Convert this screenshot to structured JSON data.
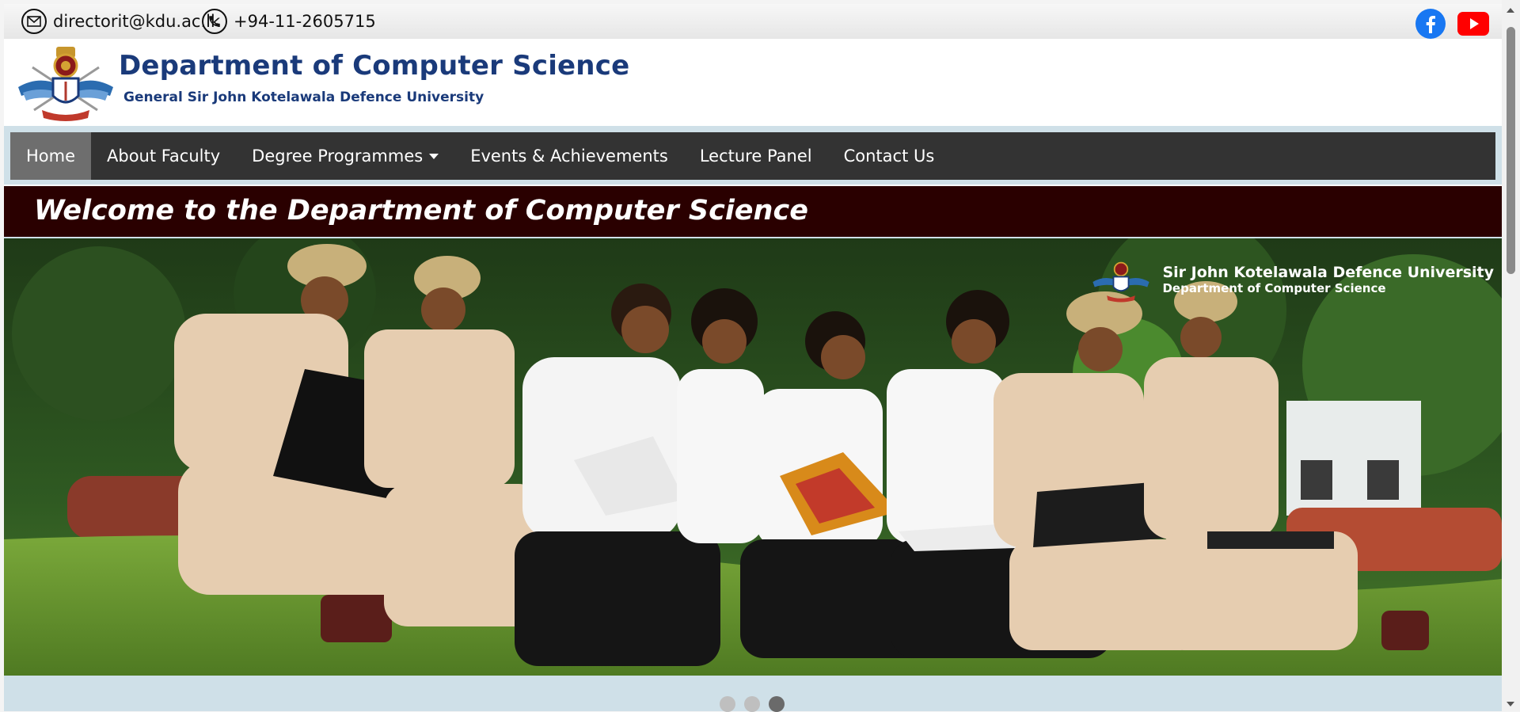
{
  "topbar": {
    "email": "directorit@kdu.ac.lk",
    "phone": "+94-11-2605715",
    "email_icon": "envelope-icon",
    "phone_icon": "phone-icon",
    "social": [
      {
        "name": "facebook-icon",
        "color": "#1877F2"
      },
      {
        "name": "youtube-icon",
        "color": "#FF0000"
      }
    ]
  },
  "header": {
    "title": "Department of Computer Science",
    "subtitle": "General Sir John Kotelawala Defence University",
    "logo": "kdu-crest-logo"
  },
  "nav": {
    "items": [
      {
        "label": "Home",
        "active": true
      },
      {
        "label": "About Faculty"
      },
      {
        "label": "Degree Programmes",
        "dropdown": true
      },
      {
        "label": "Events & Achievements"
      },
      {
        "label": "Lecture Panel"
      },
      {
        "label": "Contact Us"
      }
    ]
  },
  "welcome": {
    "text": "Welcome to the Department of Computer Science"
  },
  "hero": {
    "brand_line1": "Sir John Kotelawala Defence University",
    "brand_line2": "Department of Computer Science",
    "image": "students-with-laptops-photo"
  },
  "carousel": {
    "slides": 3,
    "active_index": 2
  },
  "colors": {
    "nav_bg": "#333333",
    "nav_active": "#6e6e6e",
    "welcome_bg": "#2a0000",
    "title_blue": "#1a3a7a",
    "page_bg": "#cfe0e8"
  }
}
